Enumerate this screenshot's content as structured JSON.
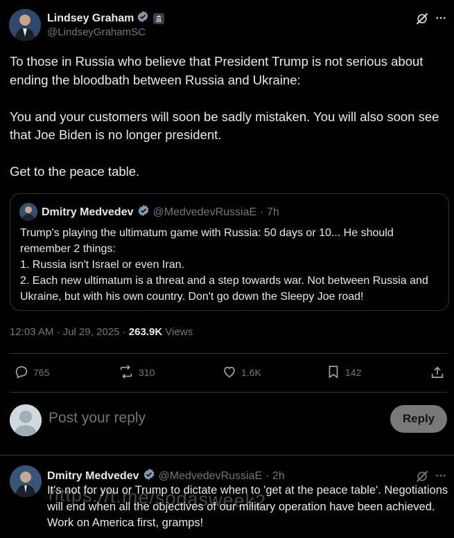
{
  "post": {
    "author_name": "Lindsey Graham",
    "author_handle": "@LindseyGrahamSC",
    "text": "To those in Russia who believe that President Trump is not serious about ending the bloodbath between Russia and Ukraine:\n\nYou and your customers will soon be sadly mistaken. You will also soon see that Joe Biden is no longer president.\n\nGet to the peace table.",
    "time": "12:03 AM · Jul 29, 2025 · ",
    "views_count": "263.9K",
    "views_label": " Views"
  },
  "quote": {
    "author_name": "Dmitry Medvedev",
    "author_handle": "@MedvedevRussiaE",
    "time": "· 7h",
    "text": "Trump's playing the ultimatum game with Russia: 50 days or 10... He should remember 2 things:\n1. Russia isn't Israel or even Iran.\n2. Each new ultimatum is a threat and a step towards war. Not between Russia and Ukraine, but with his own country. Don't go down the Sleepy Joe road!"
  },
  "actions": {
    "replies": "765",
    "reposts": "310",
    "likes": "1.6K",
    "bookmarks": "142"
  },
  "compose": {
    "placeholder": "Post your reply",
    "button": "Reply"
  },
  "reply": {
    "author_name": "Dmitry Medvedev",
    "author_handle": "@MedvedevRussiaE",
    "time": "· 2h",
    "text": "It's not for you or Trump to dictate when to 'get at the peace table'. Negotiations will end when all the objectives of our military operation have been achieved. Work on America first, gramps!"
  },
  "watermark": "https://t.me/sodasweek2",
  "colors": {
    "background": "#000000",
    "verified": "#829aab",
    "muted": "#71767b",
    "border": "#2f3336"
  }
}
